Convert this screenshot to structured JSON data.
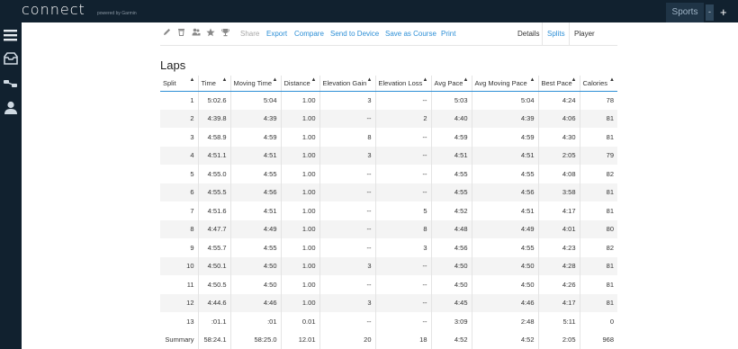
{
  "header": {
    "logo": "connect",
    "powered": "powered by Garmin",
    "sports_label": "Sports",
    "sports_dropdown": "-",
    "add_label": "+"
  },
  "sidebar": {
    "icons": [
      "menu-icon",
      "inbox-icon",
      "connections-icon",
      "profile-icon"
    ]
  },
  "toolbar": {
    "icons": [
      "edit-icon",
      "delete-icon",
      "people-icon",
      "star-icon",
      "trophy-icon"
    ],
    "actions": [
      "Share",
      "Export",
      "Compare",
      "Send to Device",
      "Save as Course",
      "Print"
    ],
    "tabs": [
      "Details",
      "Splits",
      "Player"
    ],
    "active_tab": "Splits"
  },
  "laps": {
    "title": "Laps",
    "columns": [
      "Split",
      "Time",
      "Moving Time",
      "Distance",
      "Elevation Gain",
      "Elevation Loss",
      "Avg Pace",
      "Avg Moving Pace",
      "Best Pace",
      "Calories"
    ],
    "rows": [
      [
        "1",
        "5:02.6",
        "5:04",
        "1.00",
        "3",
        "--",
        "5:03",
        "5:04",
        "4:24",
        "78"
      ],
      [
        "2",
        "4:39.8",
        "4:39",
        "1.00",
        "--",
        "2",
        "4:40",
        "4:39",
        "4:06",
        "81"
      ],
      [
        "3",
        "4:58.9",
        "4:59",
        "1.00",
        "8",
        "--",
        "4:59",
        "4:59",
        "4:30",
        "81"
      ],
      [
        "4",
        "4:51.1",
        "4:51",
        "1.00",
        "3",
        "--",
        "4:51",
        "4:51",
        "2:05",
        "79"
      ],
      [
        "5",
        "4:55.0",
        "4:55",
        "1.00",
        "--",
        "--",
        "4:55",
        "4:55",
        "4:08",
        "82"
      ],
      [
        "6",
        "4:55.5",
        "4:56",
        "1.00",
        "--",
        "--",
        "4:55",
        "4:56",
        "3:58",
        "81"
      ],
      [
        "7",
        "4:51.6",
        "4:51",
        "1.00",
        "--",
        "5",
        "4:52",
        "4:51",
        "4:17",
        "81"
      ],
      [
        "8",
        "4:47.7",
        "4:49",
        "1.00",
        "--",
        "8",
        "4:48",
        "4:49",
        "4:01",
        "80"
      ],
      [
        "9",
        "4:55.7",
        "4:55",
        "1.00",
        "--",
        "3",
        "4:56",
        "4:55",
        "4:23",
        "82"
      ],
      [
        "10",
        "4:50.1",
        "4:50",
        "1.00",
        "3",
        "--",
        "4:50",
        "4:50",
        "4:28",
        "81"
      ],
      [
        "11",
        "4:50.5",
        "4:50",
        "1.00",
        "--",
        "--",
        "4:50",
        "4:50",
        "4:26",
        "81"
      ],
      [
        "12",
        "4:44.6",
        "4:46",
        "1.00",
        "3",
        "--",
        "4:45",
        "4:46",
        "4:17",
        "81"
      ],
      [
        "13",
        ":01.1",
        ":01",
        "0.01",
        "--",
        "--",
        "3:09",
        "2:48",
        "5:11",
        "0"
      ]
    ],
    "summary": [
      "Summary",
      "58:24.1",
      "58:25.0",
      "12.01",
      "20",
      "18",
      "4:52",
      "4:52",
      "2:05",
      "968"
    ]
  },
  "colors": {
    "header_bg": "#11212f",
    "accent": "#2d8fd6"
  }
}
